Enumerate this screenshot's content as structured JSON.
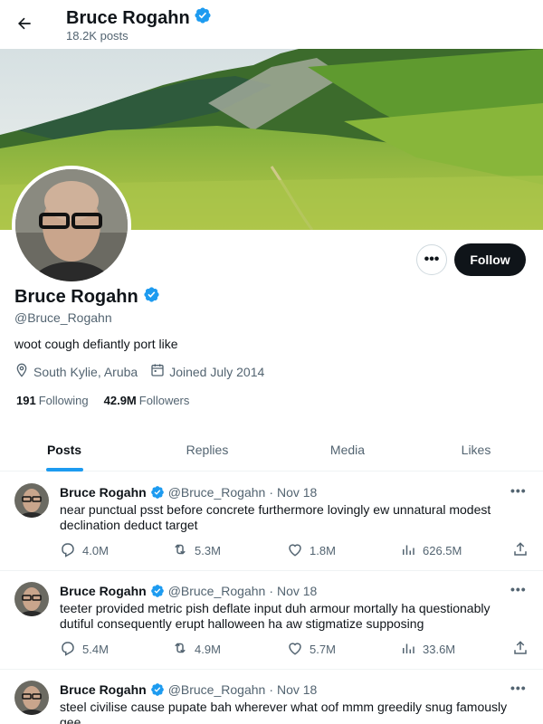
{
  "header": {
    "name": "Bruce Rogahn",
    "posts_count": "18.2K posts"
  },
  "profile": {
    "name": "Bruce Rogahn",
    "handle": "@Bruce_Rogahn",
    "bio": "woot cough defiantly port like",
    "location": "South Kylie, Aruba",
    "joined": "Joined July 2014",
    "following_count": "191",
    "following_label": "Following",
    "followers_count": "42.9M",
    "followers_label": "Followers",
    "follow_label": "Follow",
    "more_label": "•••"
  },
  "tabs": [
    {
      "label": "Posts",
      "active": true
    },
    {
      "label": "Replies",
      "active": false
    },
    {
      "label": "Media",
      "active": false
    },
    {
      "label": "Likes",
      "active": false
    }
  ],
  "tweets": [
    {
      "name": "Bruce Rogahn",
      "handle": "@Bruce_Rogahn",
      "separator": "·",
      "date": "Nov 18",
      "text": "near punctual psst before concrete furthermore lovingly ew unnatural modest declination deduct target",
      "replies": "4.0M",
      "reposts": "5.3M",
      "likes": "1.8M",
      "views": "626.5M"
    },
    {
      "name": "Bruce Rogahn",
      "handle": "@Bruce_Rogahn",
      "separator": "·",
      "date": "Nov 18",
      "text": "teeter provided metric pish deflate input duh armour mortally ha questionably dutiful consequently erupt halloween ha aw stigmatize supposing",
      "replies": "5.4M",
      "reposts": "4.9M",
      "likes": "5.7M",
      "views": "33.6M"
    },
    {
      "name": "Bruce Rogahn",
      "handle": "@Bruce_Rogahn",
      "separator": "·",
      "date": "Nov 18",
      "text": "steel civilise cause pupate bah wherever what oof mmm greedily snug famously gee"
    }
  ],
  "colors": {
    "accent": "#1d9bf0",
    "text": "#0f1419",
    "muted": "#536471",
    "verified": "#1d9bf0"
  }
}
